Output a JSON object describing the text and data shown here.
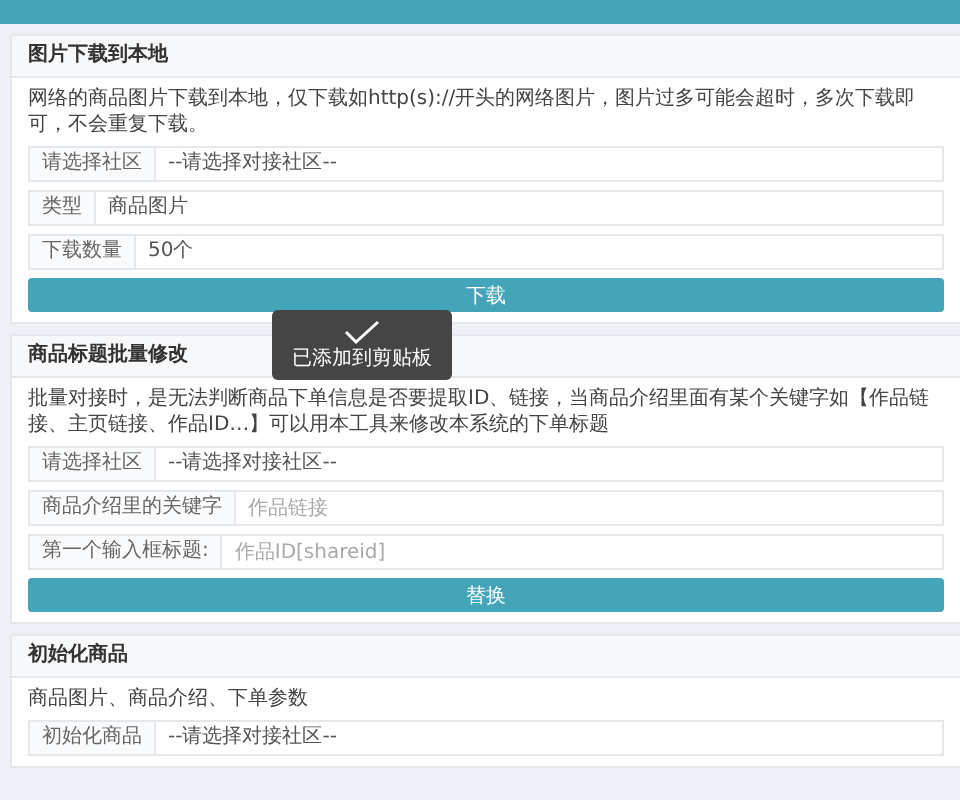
{
  "sections": [
    {
      "title": "图片下载到本地",
      "description": "网络的商品图片下载到本地，仅下载如http(s)://开头的网络图片，图片过多可能会超时，多次下载即可，不会重复下载。",
      "fields": [
        {
          "kind": "select",
          "label": "请选择社区",
          "value": "--请选择对接社区--"
        },
        {
          "kind": "text",
          "label": "类型",
          "value": "商品图片"
        },
        {
          "kind": "text",
          "label": "下载数量",
          "value": "50个"
        }
      ],
      "button": "下载"
    },
    {
      "title": "商品标题批量修改",
      "description": "批量对接时，是无法判断商品下单信息是否要提取ID、链接，当商品介绍里面有某个关键字如【作品链接、主页链接、作品ID…】可以用本工具来修改本系统的下单标题",
      "fields": [
        {
          "kind": "select",
          "label": "请选择社区",
          "value": "--请选择对接社区--"
        },
        {
          "kind": "input",
          "label": "商品介绍里的关键字",
          "placeholder": "作品链接"
        },
        {
          "kind": "input",
          "label": "第一个输入框标题:",
          "placeholder": "作品ID[shareid]"
        }
      ],
      "button": "替换"
    },
    {
      "title": "初始化商品",
      "description": "商品图片、商品介绍、下单参数",
      "fields": [
        {
          "kind": "select",
          "label": "初始化商品",
          "value": "--请选择对接社区--"
        }
      ]
    }
  ],
  "toast": {
    "message": "已添加到剪贴板"
  }
}
